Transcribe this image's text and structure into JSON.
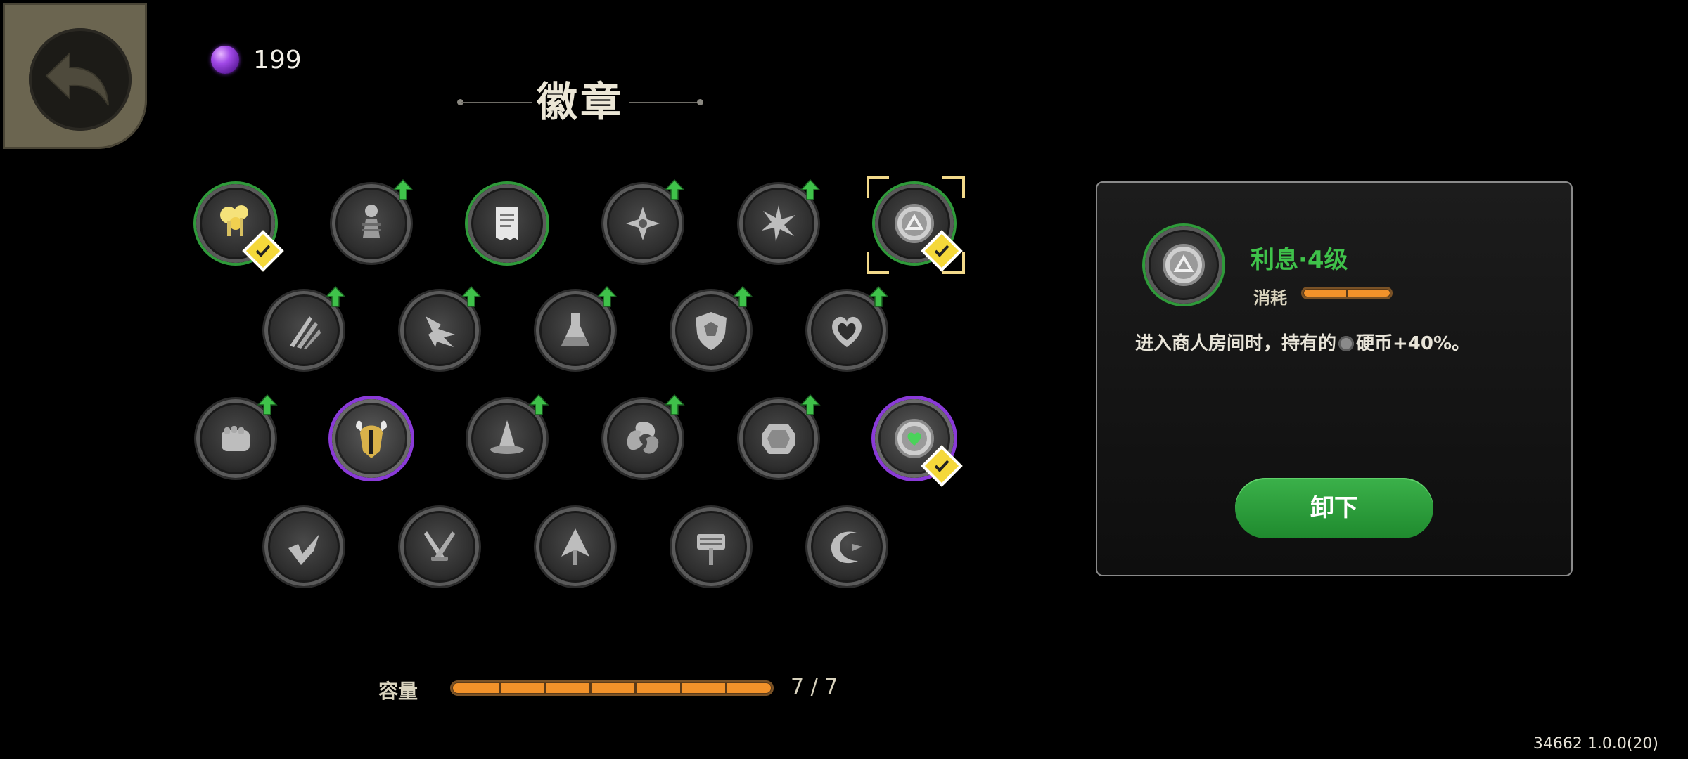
{
  "currency": {
    "icon": "purple-orb-icon",
    "value": "199"
  },
  "title": "徽章",
  "badges": [
    {
      "row": 1,
      "icon": "mushroom-icon",
      "frame": "green",
      "upgrade": false,
      "equipped": true,
      "selected": false
    },
    {
      "row": 1,
      "icon": "pawn-icon",
      "frame": "gray",
      "upgrade": true,
      "equipped": false,
      "selected": false
    },
    {
      "row": 1,
      "icon": "receipt-icon",
      "frame": "green",
      "upgrade": false,
      "equipped": false,
      "selected": false
    },
    {
      "row": 1,
      "icon": "compass-star-icon",
      "frame": "gray",
      "upgrade": true,
      "equipped": false,
      "selected": false
    },
    {
      "row": 1,
      "icon": "spark-star-icon",
      "frame": "gray",
      "upgrade": true,
      "equipped": false,
      "selected": false
    },
    {
      "row": 1,
      "icon": "coin-triangle-icon",
      "frame": "green",
      "upgrade": false,
      "equipped": true,
      "selected": true
    },
    {
      "row": 2,
      "icon": "claw-icon",
      "frame": "gray",
      "upgrade": true,
      "equipped": false,
      "selected": false
    },
    {
      "row": 2,
      "icon": "impact-arrow-icon",
      "frame": "gray",
      "upgrade": true,
      "equipped": false,
      "selected": false
    },
    {
      "row": 2,
      "icon": "flask-icon",
      "frame": "gray",
      "upgrade": true,
      "equipped": false,
      "selected": false
    },
    {
      "row": 2,
      "icon": "shield-icon",
      "frame": "gray",
      "upgrade": true,
      "equipped": false,
      "selected": false
    },
    {
      "row": 2,
      "icon": "heart-icon",
      "frame": "gray",
      "upgrade": true,
      "equipped": false,
      "selected": false
    },
    {
      "row": 3,
      "icon": "fist-icon",
      "frame": "gray",
      "upgrade": true,
      "equipped": false,
      "selected": false
    },
    {
      "row": 3,
      "icon": "viking-helmet-icon",
      "frame": "purple",
      "upgrade": false,
      "equipped": false,
      "selected": false
    },
    {
      "row": 3,
      "icon": "wizard-hat-icon",
      "frame": "gray",
      "upgrade": true,
      "equipped": false,
      "selected": false
    },
    {
      "row": 3,
      "icon": "swirl-icon",
      "frame": "gray",
      "upgrade": true,
      "equipped": false,
      "selected": false
    },
    {
      "row": 3,
      "icon": "gem-icon",
      "frame": "gray",
      "upgrade": true,
      "equipped": false,
      "selected": false
    },
    {
      "row": 3,
      "icon": "heart-coin-icon",
      "frame": "purple",
      "upgrade": false,
      "equipped": true,
      "selected": false
    },
    {
      "row": 4,
      "icon": "dash-arrow-icon",
      "frame": "gray",
      "upgrade": false,
      "equipped": false,
      "selected": false
    },
    {
      "row": 4,
      "icon": "crossed-daggers-icon",
      "frame": "gray",
      "upgrade": false,
      "equipped": false,
      "selected": false
    },
    {
      "row": 4,
      "icon": "arrowhead-icon",
      "frame": "gray",
      "upgrade": false,
      "equipped": false,
      "selected": false
    },
    {
      "row": 4,
      "icon": "hammer-icon",
      "frame": "gray",
      "upgrade": false,
      "equipped": false,
      "selected": false
    },
    {
      "row": 4,
      "icon": "crescent-icon",
      "frame": "gray",
      "upgrade": false,
      "equipped": false,
      "selected": false
    }
  ],
  "capacity": {
    "label": "容量",
    "value_text": "7 / 7",
    "used": 7,
    "max": 7
  },
  "detail": {
    "icon": "coin-triangle-icon",
    "name": "利息·4级",
    "cost_label": "消耗",
    "cost": 2,
    "description_before": "进入商人房间时，持有的",
    "description_coin_icon": "coin-icon",
    "description_after": "硬币+40%。",
    "unequip_label": "卸下"
  },
  "version": "34662 1.0.0(20)",
  "colors": {
    "green": "#3fc24a",
    "purple": "#8a3ad8",
    "orange": "#f2922a",
    "highlight": "#f5d83a"
  }
}
